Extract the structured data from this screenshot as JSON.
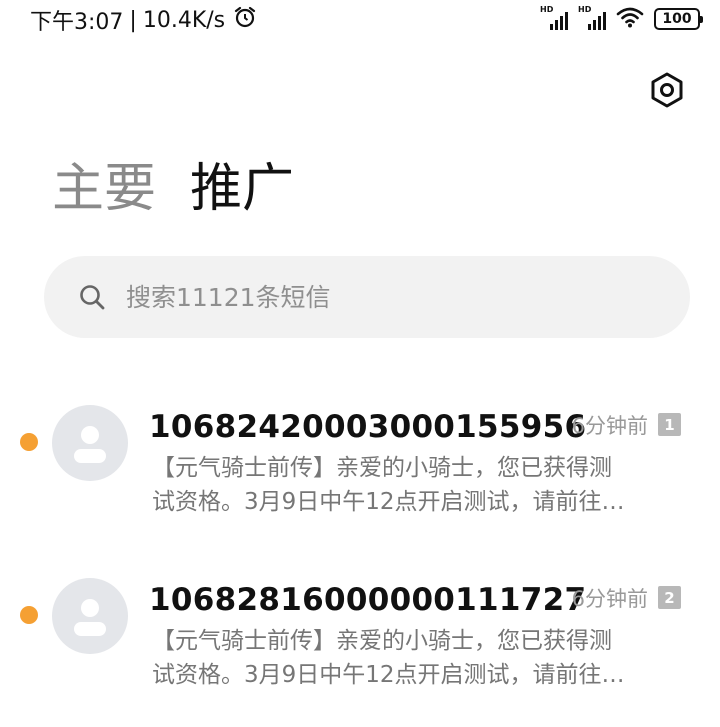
{
  "status_bar": {
    "time": "下午3:07",
    "separator": "|",
    "network_speed": "10.4K/s",
    "alarm_icon": "alarm-clock-icon",
    "sim1_label": "HD",
    "sim2_label": "HD",
    "wifi_icon": "wifi-icon",
    "battery": "100"
  },
  "header": {
    "settings_icon": "settings-hexagon-icon",
    "tabs": [
      {
        "label": "主要",
        "active": false
      },
      {
        "label": "推广",
        "active": true
      }
    ]
  },
  "search": {
    "icon": "search-icon",
    "placeholder": "搜索11121条短信"
  },
  "messages": [
    {
      "sender": "106824200030001559 56",
      "time": "6分钟前",
      "sim": "1",
      "preview_line1": "【元气骑士前传】亲爱的小骑士，您已获得测",
      "preview_line2": "试资格。3月9日中午12点开启测试，请前往…",
      "unread": true
    },
    {
      "sender": "10682816000000111727",
      "time": "6分钟前",
      "sim": "2",
      "preview_line1": "【元气骑士前传】亲爱的小骑士，您已获得测",
      "preview_line2": "试资格。3月9日中午12点开启测试，请前往…",
      "unread": true
    }
  ],
  "colors": {
    "unread_dot": "#f5a033",
    "avatar_bg": "#e4e6ea",
    "search_bg": "#f2f2f2"
  }
}
